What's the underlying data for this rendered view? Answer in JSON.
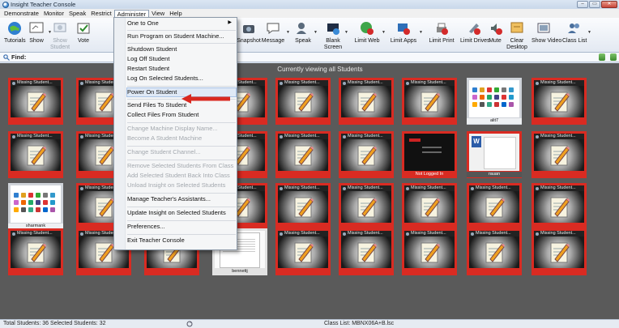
{
  "window": {
    "title": "Insight Teacher Console",
    "buttons": [
      "–",
      "▭",
      "✕"
    ]
  },
  "menubar": [
    "Demonstrate",
    "Monitor",
    "Speak",
    "Restrict",
    "Administer",
    "View",
    "Help"
  ],
  "toolbar": {
    "tutorials": "Tutorials",
    "show": "Show",
    "show_student": "Show Student",
    "vote": "Vote",
    "snapshot": "Snapshot",
    "message": "Message",
    "speak": "Speak",
    "blank_screen": "Blank Screen",
    "limit_web": "Limit Web",
    "limit_apps": "Limit Apps",
    "limit_print": "Limit Print",
    "limit_drives": "Limit Drives",
    "mute": "Mute",
    "clear_desktop": "Clear Desktop",
    "show_video": "Show Video",
    "class_list": "Class List"
  },
  "find": {
    "label": "Find:",
    "value": ""
  },
  "main": {
    "viewing": "Currently viewing all Students"
  },
  "tiles": {
    "missing": "Missing Student...",
    "student_names": {
      "sharmank": "sharmank",
      "alit7": "alit7",
      "rauan": "rauan",
      "bennettj": "bennettj",
      "not_logged_in": "Not Logged In"
    }
  },
  "administer_menu": {
    "items": [
      "One to One",
      "Run Program on Student Machine...",
      "Shutdown Student",
      "Log Off Student",
      "Restart Student",
      "Log On Selected Students...",
      "Power On Student",
      "Send Files To Student",
      "Collect Files From Student",
      "Change Machine Display Name...",
      "Become A Student Machine",
      "Change Student Channel...",
      "Remove Selected Students From Class",
      "Add Selected Student Back Into Class",
      "Unload Insight on Selected Students",
      "Manage Teacher's Assistants...",
      "Update Insight on Selected Students",
      "Preferences...",
      "Exit Teacher Console"
    ]
  },
  "status": {
    "totals": "Total Students: 36  Selected Students: 32",
    "class_list": "Class List: MBNX06A+B.lsc"
  },
  "colors": {
    "tile_red": "#d92b22",
    "callout_red": "#d9281f",
    "grid_bg": "#5a5a5a"
  }
}
